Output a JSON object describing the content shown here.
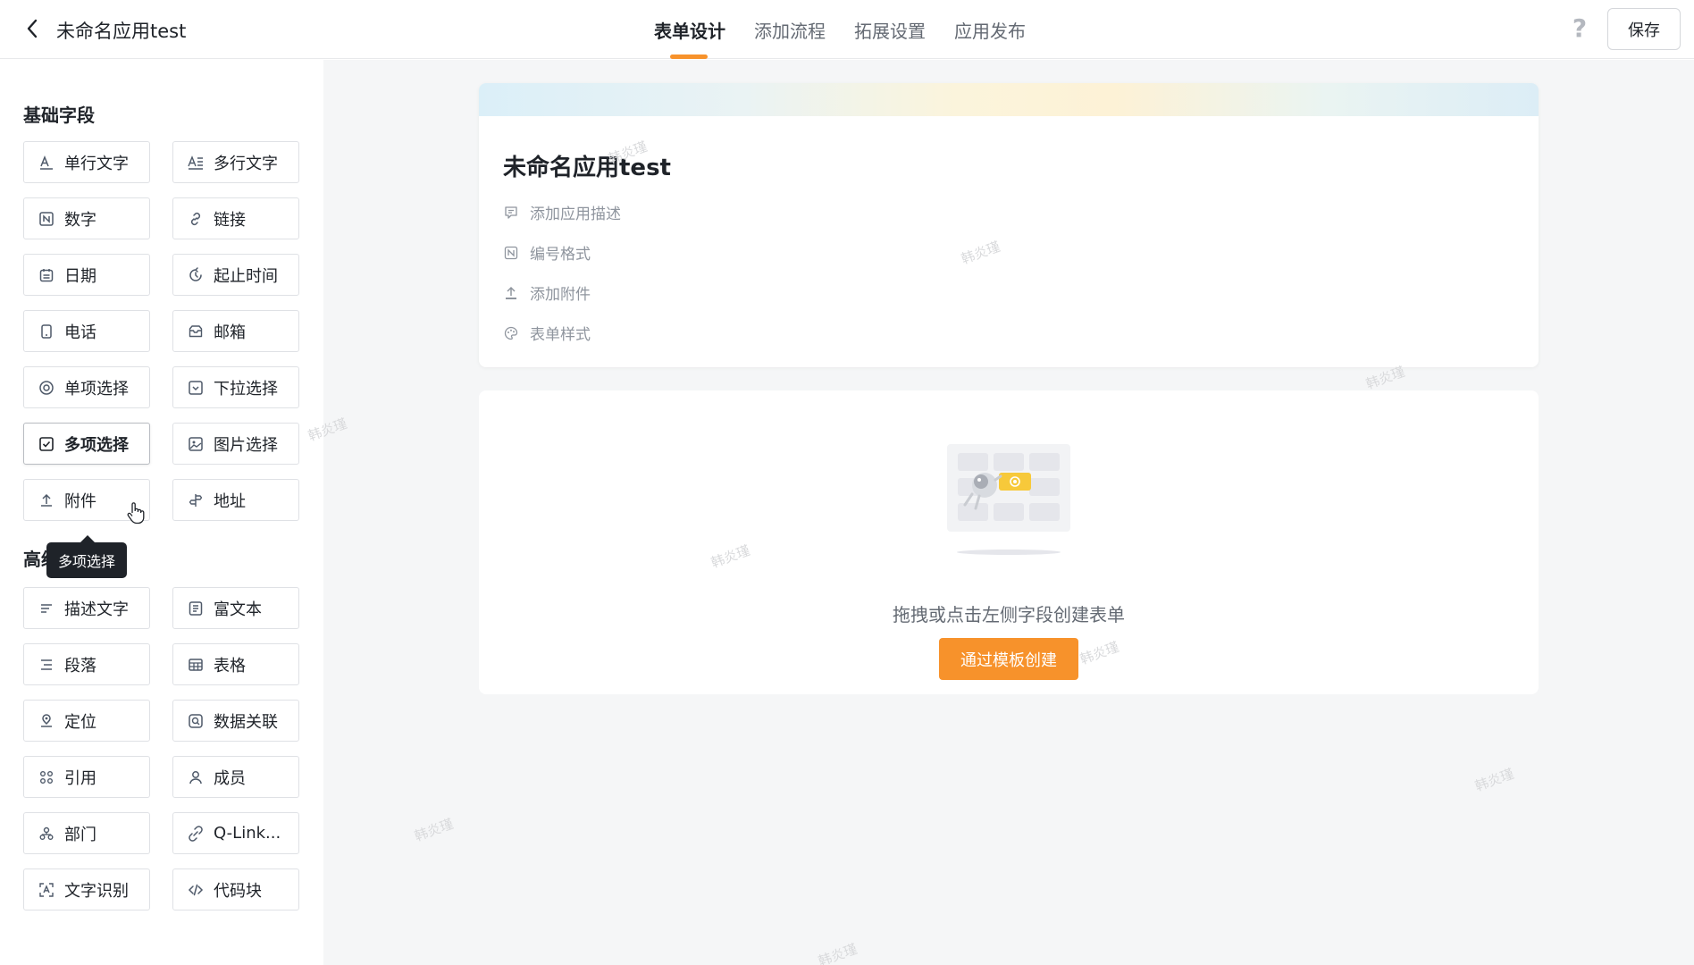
{
  "header": {
    "app_name": "未命名应用test",
    "tabs": [
      {
        "label": "表单设计",
        "active": true
      },
      {
        "label": "添加流程",
        "active": false
      },
      {
        "label": "拓展设置",
        "active": false
      },
      {
        "label": "应用发布",
        "active": false
      }
    ],
    "help_label": "?",
    "save_label": "保存"
  },
  "sidebar": {
    "basic_title": "基础字段",
    "basic_fields": [
      {
        "label": "单行文字",
        "icon": "single-line-text-icon"
      },
      {
        "label": "多行文字",
        "icon": "multi-line-text-icon"
      },
      {
        "label": "数字",
        "icon": "number-icon"
      },
      {
        "label": "链接",
        "icon": "link-icon"
      },
      {
        "label": "日期",
        "icon": "calendar-icon"
      },
      {
        "label": "起止时间",
        "icon": "time-range-icon"
      },
      {
        "label": "电话",
        "icon": "phone-icon"
      },
      {
        "label": "邮箱",
        "icon": "mail-icon"
      },
      {
        "label": "单项选择",
        "icon": "radio-icon"
      },
      {
        "label": "下拉选择",
        "icon": "dropdown-icon"
      },
      {
        "label": "多项选择",
        "icon": "checkbox-icon"
      },
      {
        "label": "图片选择",
        "icon": "image-select-icon"
      },
      {
        "label": "附件",
        "icon": "upload-icon"
      },
      {
        "label": "地址",
        "icon": "address-icon"
      }
    ],
    "advanced_title": "高级字段",
    "advanced_fields": [
      {
        "label": "描述文字",
        "icon": "description-icon"
      },
      {
        "label": "富文本",
        "icon": "rich-text-icon"
      },
      {
        "label": "段落",
        "icon": "paragraph-icon"
      },
      {
        "label": "表格",
        "icon": "table-icon"
      },
      {
        "label": "定位",
        "icon": "location-icon"
      },
      {
        "label": "数据关联",
        "icon": "data-link-icon"
      },
      {
        "label": "引用",
        "icon": "reference-icon"
      },
      {
        "label": "成员",
        "icon": "member-icon"
      },
      {
        "label": "部门",
        "icon": "department-icon"
      },
      {
        "label": "Q-Link...",
        "icon": "qlink-icon"
      },
      {
        "label": "文字识别",
        "icon": "ocr-icon"
      },
      {
        "label": "代码块",
        "icon": "code-icon"
      }
    ],
    "tooltip": "多项选择"
  },
  "form": {
    "title": "未命名应用test",
    "meta": [
      {
        "label": "添加应用描述",
        "icon": "comment-icon"
      },
      {
        "label": "编号格式",
        "icon": "number-format-icon"
      },
      {
        "label": "添加附件",
        "icon": "upload-icon"
      },
      {
        "label": "表单样式",
        "icon": "palette-icon"
      }
    ]
  },
  "canvas": {
    "empty_text": "拖拽或点击左侧字段创建表单",
    "template_button": "通过模板创建"
  },
  "watermark": "韩炎瑾",
  "colors": {
    "accent": "#f7922b",
    "text": "#1f2329",
    "muted": "#8f959e",
    "bg": "#f5f6f7"
  }
}
